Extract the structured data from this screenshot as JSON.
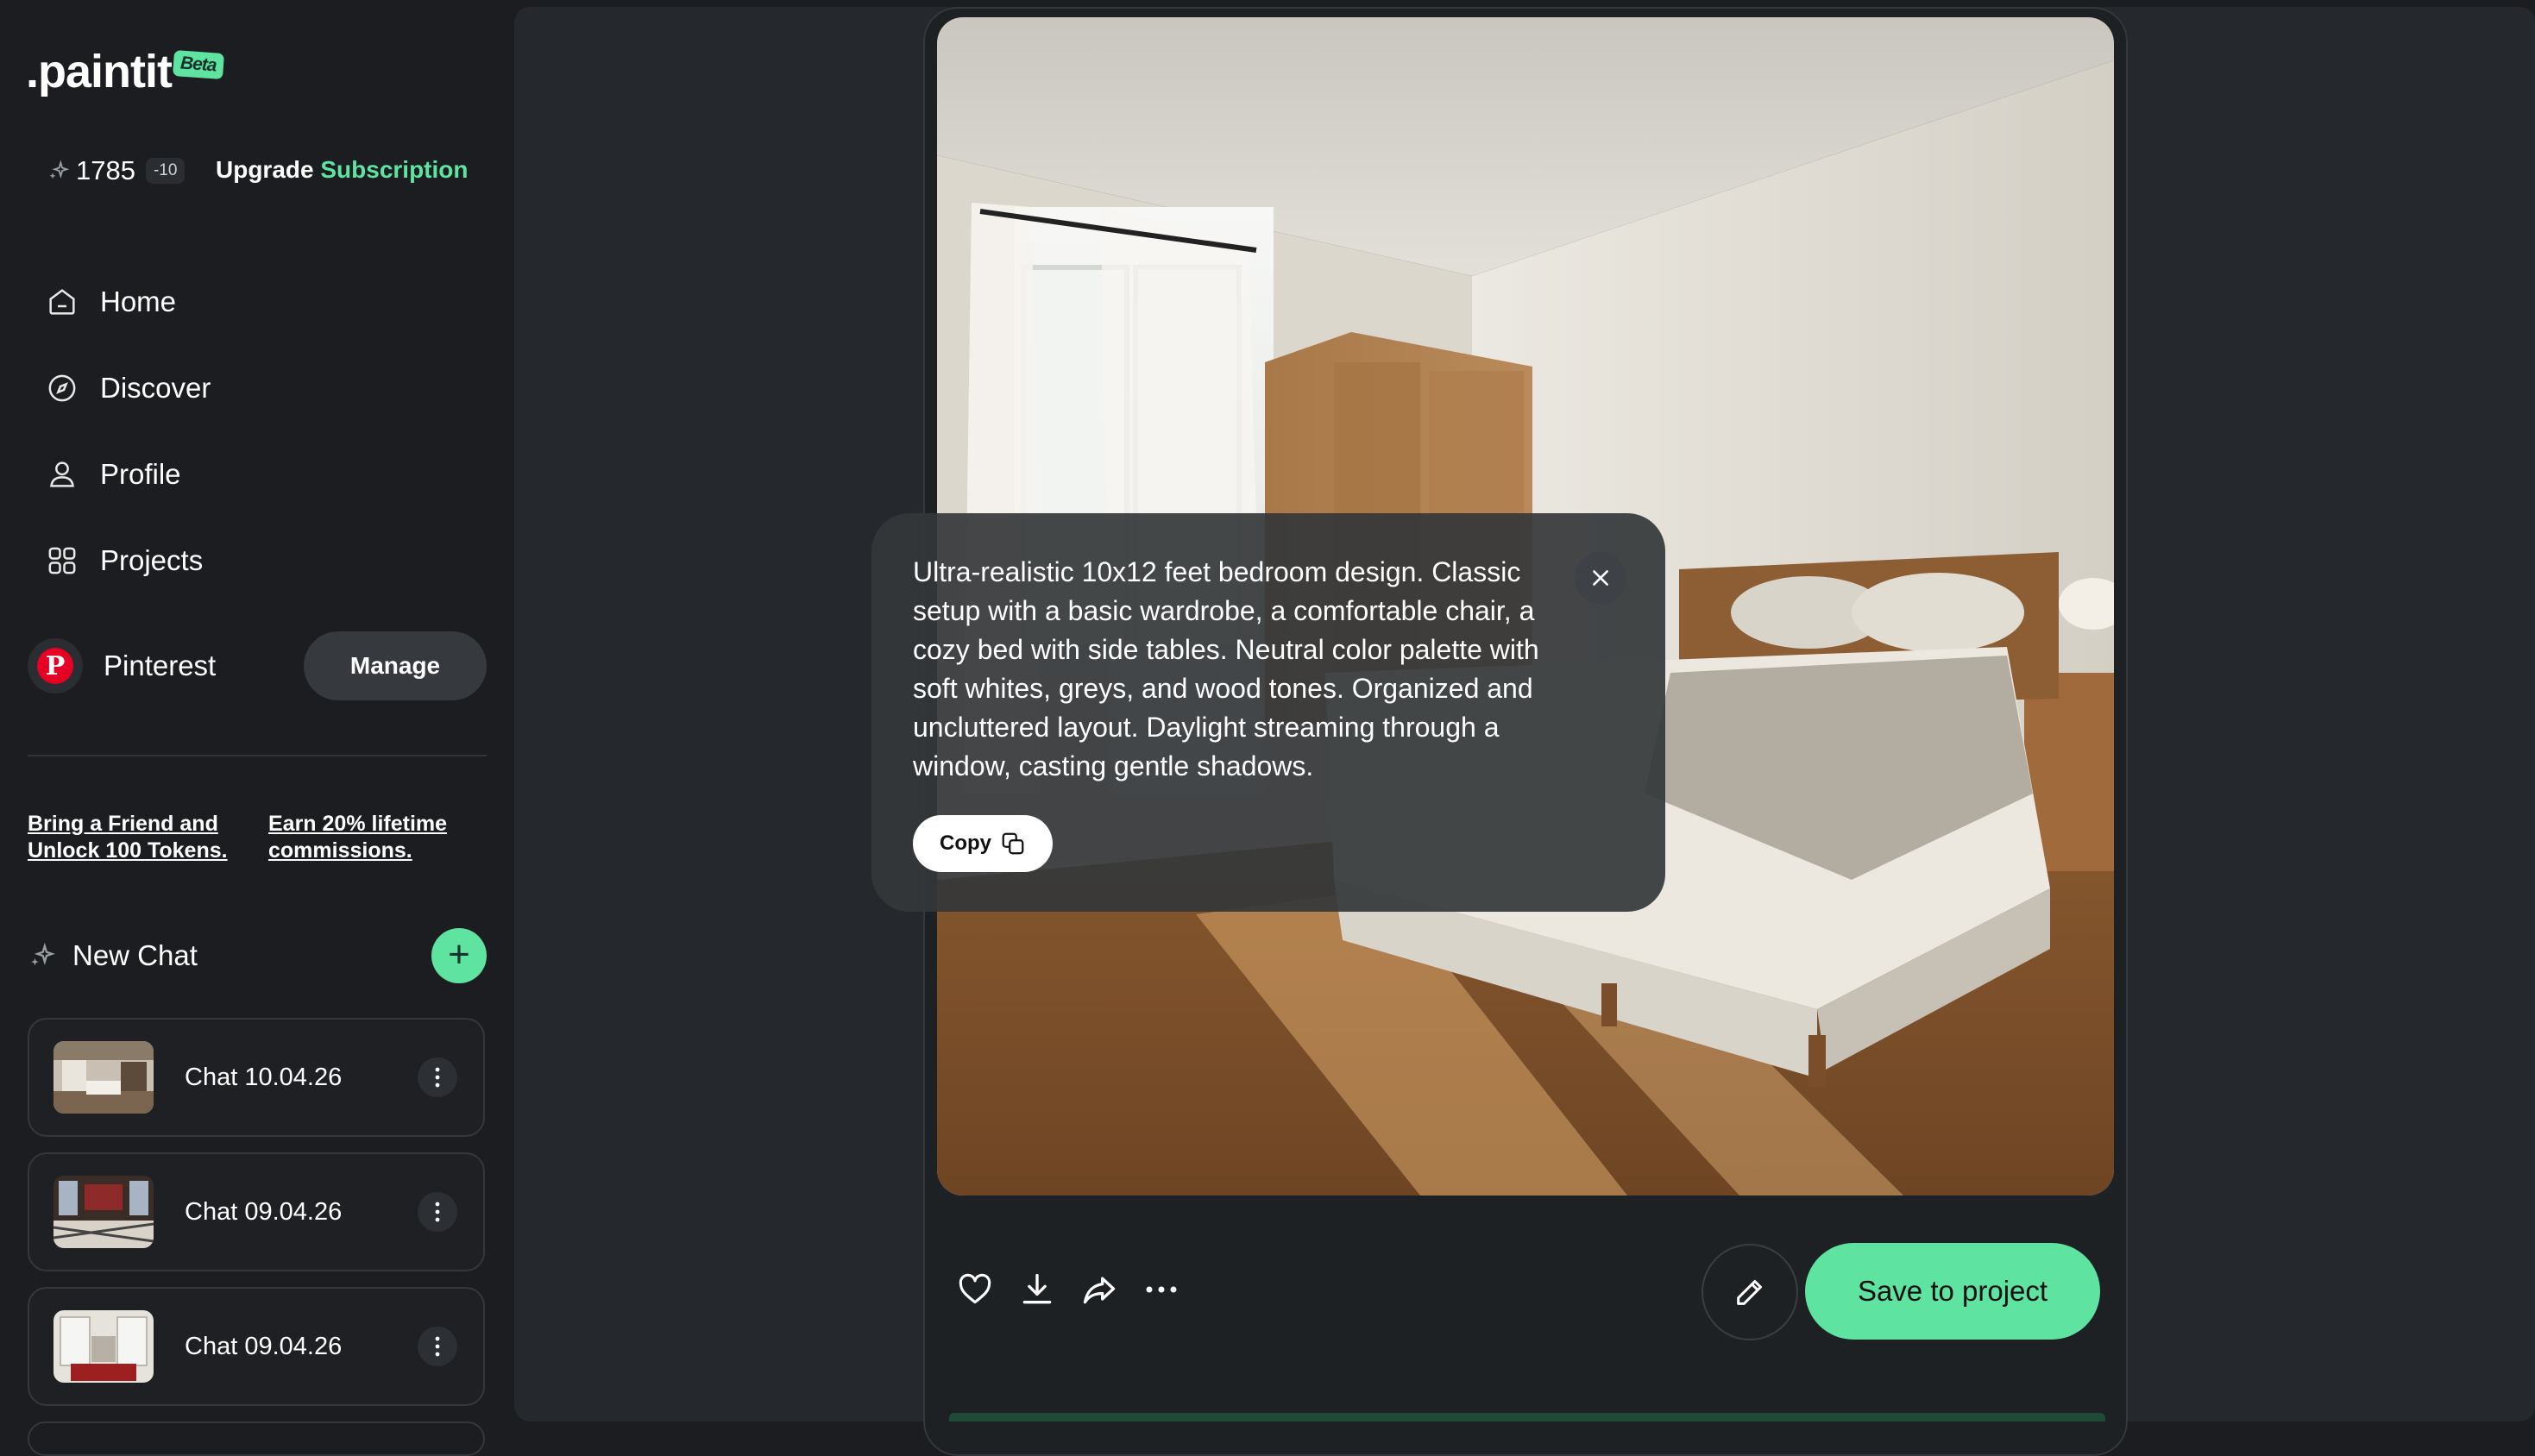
{
  "brand": {
    "name": ".paintit",
    "badge": "Beta"
  },
  "tokens": {
    "count": "1785",
    "delta": "-10",
    "icon": "sparkle-icon"
  },
  "upgrade": {
    "prefix": "Upgrade",
    "accent": "Subscription"
  },
  "nav": [
    {
      "label": "Home",
      "icon": "home-icon"
    },
    {
      "label": "Discover",
      "icon": "compass-icon"
    },
    {
      "label": "Profile",
      "icon": "user-icon"
    },
    {
      "label": "Projects",
      "icon": "grid-icon"
    }
  ],
  "pinterest": {
    "label": "Pinterest",
    "button": "Manage",
    "icon": "pinterest-icon"
  },
  "promos": {
    "referral": "Bring a Friend and Unlock 100 Tokens.",
    "affiliate": "Earn 20% lifetime commissions."
  },
  "new_chat": {
    "label": "New Chat",
    "button": "+"
  },
  "chats": [
    {
      "title": "Chat 10.04.26"
    },
    {
      "title": "Chat 09.04.26"
    },
    {
      "title": "Chat 09.04.26"
    }
  ],
  "prompt": {
    "text": "Ultra-realistic 10x12 feet bedroom design. Classic setup with a basic wardrobe, a comfortable chair, a cozy bed with side tables. Neutral color palette with soft whites, greys, and wood tones. Organized and uncluttered layout. Daylight streaming through a window, casting gentle shadows.",
    "copy_label": "Copy"
  },
  "actions": {
    "save_label": "Save to project"
  },
  "colors": {
    "accent": "#5fe3a1",
    "background": "#1b1d20",
    "panel": "#25282c"
  }
}
